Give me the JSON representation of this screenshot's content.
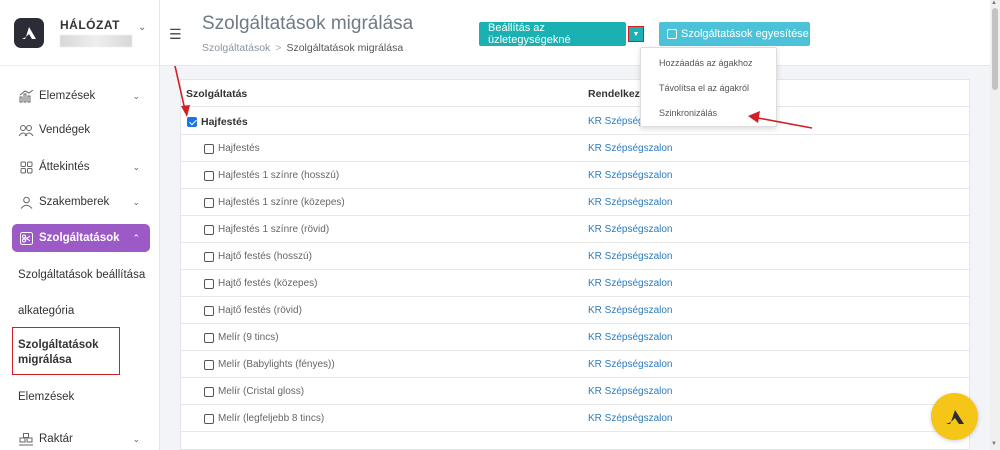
{
  "brand": {
    "title": "HÁLÓZAT",
    "subtitle": ""
  },
  "sidebar": {
    "items": [
      {
        "label": "Elemzések"
      },
      {
        "label": "Vendégek"
      },
      {
        "label": "Áttekintés"
      },
      {
        "label": "Szakemberek"
      },
      {
        "label": "Szolgáltatások"
      }
    ],
    "subitems": [
      {
        "label": "Szolgáltatások beállítása"
      },
      {
        "label": "alkategória"
      },
      {
        "label": "Szolgáltatások migrálása"
      },
      {
        "label": "Elemzések"
      }
    ],
    "bottom_item": {
      "label": "Raktár"
    }
  },
  "header": {
    "title": "Szolgáltatások migrálása",
    "breadcrumb": [
      "Szolgáltatások",
      "Szolgáltatások migrálása"
    ],
    "settings_button": "Beállítás az üzletegységekné",
    "merge_button": "Szolgáltatások egyesítése"
  },
  "dropdown": {
    "items": [
      "Hozzáadás az ágakhoz",
      "Távolítsa el az ágakról",
      "Szinkronizálás"
    ]
  },
  "table": {
    "columns": [
      "Szolgáltatás",
      "Rendelkezé"
    ],
    "parent": {
      "name": "Hajfestés",
      "branch": "KR Szépségs",
      "checked": true
    },
    "rows": [
      {
        "name": "Hajfestés",
        "branch": "KR Szépségszalon"
      },
      {
        "name": "Hajfestés 1 színre (hosszú)",
        "branch": "KR Szépségszalon"
      },
      {
        "name": "Hajfestés 1 színre (közepes)",
        "branch": "KR Szépségszalon"
      },
      {
        "name": "Hajfestés 1 színre (rövid)",
        "branch": "KR Szépségszalon"
      },
      {
        "name": "Hajtő festés (hosszú)",
        "branch": "KR Szépségszalon"
      },
      {
        "name": "Hajtő festés (közepes)",
        "branch": "KR Szépségszalon"
      },
      {
        "name": "Hajtő festés (rövid)",
        "branch": "KR Szépségszalon"
      },
      {
        "name": "Melír (9 tincs)",
        "branch": "KR Szépségszalon"
      },
      {
        "name": "Melír (Babylights (fényes))",
        "branch": "KR Szépségszalon"
      },
      {
        "name": "Melír (Cristal gloss)",
        "branch": "KR Szépségszalon"
      },
      {
        "name": "Melír (legfeljebb 8 tincs)",
        "branch": "KR Szépségszalon"
      }
    ]
  },
  "colors": {
    "accent_purple": "#9c5ac7",
    "teal": "#1bb1b3",
    "cyan": "#4cc2d9",
    "annotation_red": "#d21f25",
    "fab_yellow": "#f5c518"
  }
}
